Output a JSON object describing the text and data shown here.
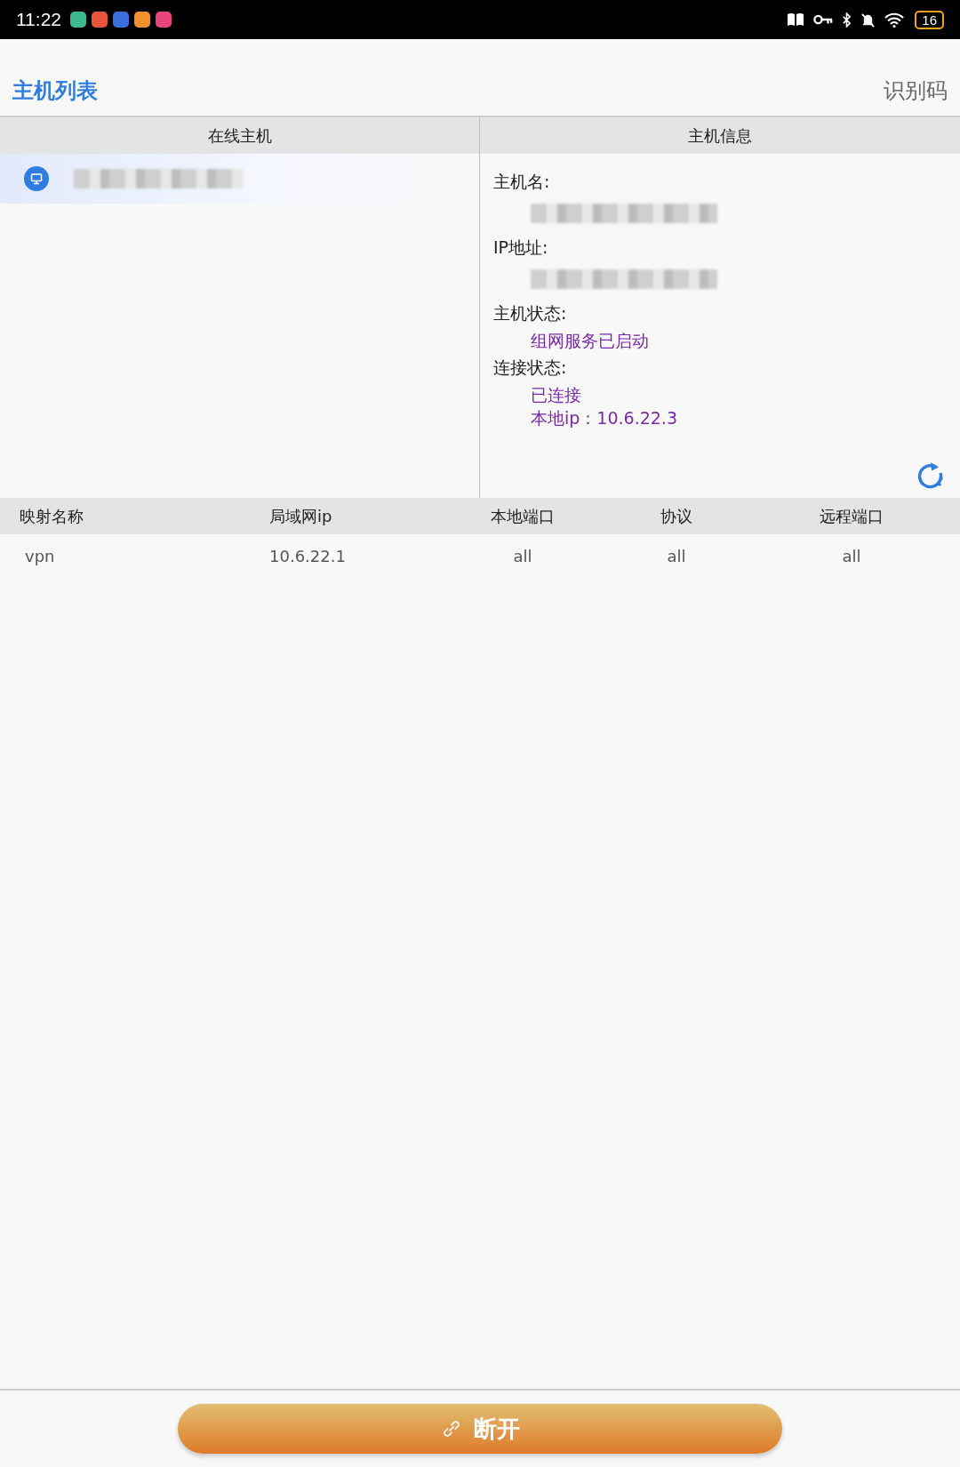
{
  "status_bar": {
    "time": "11:22",
    "notification_icons": [
      {
        "color": "#3dba8f"
      },
      {
        "color": "#e8553a"
      },
      {
        "color": "#3b6fe0"
      },
      {
        "color": "#f0902e"
      },
      {
        "color": "#e8457a"
      }
    ],
    "battery": "16"
  },
  "header": {
    "title": "主机列表",
    "action": "识别码"
  },
  "host_list": {
    "heading": "在线主机",
    "hosts": [
      {
        "selected": true
      }
    ]
  },
  "host_info": {
    "heading": "主机信息",
    "fields": [
      {
        "label": "主机名:",
        "kind": "redacted"
      },
      {
        "label": "IP地址:",
        "kind": "redacted"
      },
      {
        "label": "主机状态:",
        "kind": "text",
        "lines": [
          "组网服务已启动"
        ]
      },
      {
        "label": "连接状态:",
        "kind": "text",
        "lines": [
          "已连接",
          "本地ip：10.6.22.3"
        ]
      }
    ]
  },
  "table": {
    "columns": [
      "映射名称",
      "局域网ip",
      "本地端口",
      "协议",
      "远程端口"
    ],
    "rows": [
      [
        "vpn",
        "10.6.22.1",
        "all",
        "all",
        "all"
      ]
    ]
  },
  "disconnect_button": {
    "label": "断开"
  }
}
